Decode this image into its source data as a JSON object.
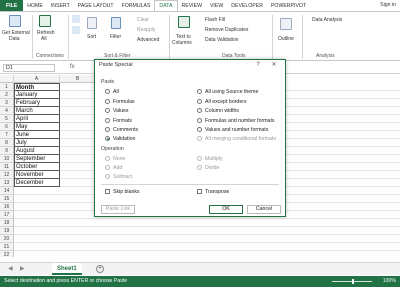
{
  "ribbon_tabs": [
    "FILE",
    "HOME",
    "INSERT",
    "PAGE LAYOUT",
    "FORMULAS",
    "DATA",
    "REVIEW",
    "VIEW",
    "DEVELOPER",
    "POWERPIVOT"
  ],
  "active_tab": "DATA",
  "sign_in": "Sign in",
  "ribbon": {
    "get_external": "Get External",
    "get_external_2": "Data",
    "refresh": "Refresh",
    "refresh_2": "All",
    "connections": "Connections",
    "sort": "Sort",
    "filter": "Filter",
    "clear": "Clear",
    "reapply": "Reapply",
    "advanced": "Advanced",
    "sort_filter": "Sort & Filter",
    "text_to": "Text to",
    "columns": "Columns",
    "flash_fill": "Flash Fill",
    "remove_dup": "Remove Duplicates",
    "data_validation": "Data Validation",
    "data_tools": "Data Tools",
    "outline": "Outline",
    "data_analysis": "Data Analysis",
    "analysis": "Analysis"
  },
  "name_box": "D1",
  "fx": "fx",
  "columns": [
    "A",
    "B"
  ],
  "rows": [
    "1",
    "2",
    "3",
    "4",
    "5",
    "6",
    "7",
    "8",
    "9",
    "10",
    "11",
    "12",
    "13",
    "14",
    "15",
    "16",
    "17",
    "18",
    "19",
    "20",
    "21",
    "22"
  ],
  "cells": [
    "Month",
    "January",
    "February",
    "March",
    "April",
    "May",
    "June",
    "July",
    "August",
    "September",
    "October",
    "November",
    "December"
  ],
  "sheet_tab": "Sheet1",
  "add_sheet": "+",
  "status_text": "Select destination and press ENTER or choose Paste",
  "zoom_level": "100%",
  "zoom_fraction": 0.5,
  "dialog": {
    "title": "Paste Special",
    "help": "?",
    "close": "✕",
    "paste_label": "Paste",
    "paste_left": [
      "All",
      "Formulas",
      "Values",
      "Formats",
      "Comments",
      "Validation"
    ],
    "paste_right": [
      "All using Source theme",
      "All except borders",
      "Column widths",
      "Formulas and number formats",
      "Values and number formats",
      "All merging conditional formats"
    ],
    "selected": "Validation",
    "operation_label": "Operation",
    "op_left": [
      "None",
      "Add",
      "Subtract"
    ],
    "op_right": [
      "Multiply",
      "Divide"
    ],
    "skip_blanks": "Skip blanks",
    "transpose": "Transpose",
    "paste_link": "Paste Link",
    "ok": "OK",
    "cancel": "Cancel"
  },
  "colors": {
    "accent": "#217346"
  }
}
